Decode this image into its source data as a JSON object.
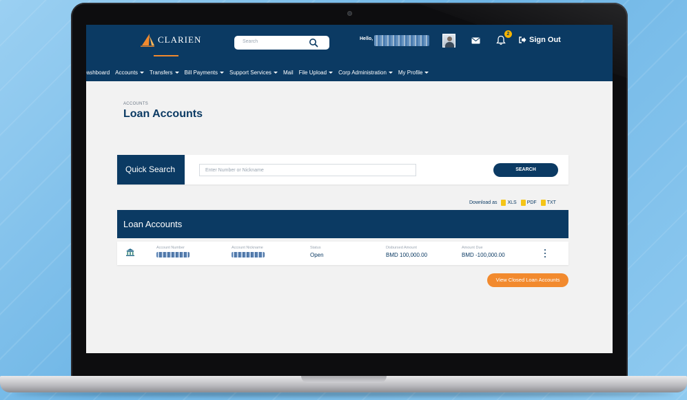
{
  "header": {
    "logo_text": "CLARIEN",
    "search_placeholder": "Search",
    "greeting": "Hello,",
    "notification_count": "2",
    "sign_out_label": "Sign Out"
  },
  "nav": {
    "items": [
      {
        "label": "Dashboard",
        "dropdown": false
      },
      {
        "label": "Accounts",
        "dropdown": true
      },
      {
        "label": "Transfers",
        "dropdown": true
      },
      {
        "label": "Bill Payments",
        "dropdown": true
      },
      {
        "label": "Support Services",
        "dropdown": true
      },
      {
        "label": "Mail",
        "dropdown": false
      },
      {
        "label": "File Upload",
        "dropdown": true
      },
      {
        "label": "Corp Administration",
        "dropdown": true
      },
      {
        "label": "My Profile",
        "dropdown": true
      }
    ]
  },
  "page": {
    "breadcrumb": "ACCOUNTS",
    "title": "Loan Accounts"
  },
  "quick_search": {
    "label": "Quick Search",
    "input_placeholder": "Enter Number or Nickname",
    "button_label": "SEARCH"
  },
  "download": {
    "label": "Download as",
    "formats": [
      "XLS",
      "PDF",
      "TXT"
    ]
  },
  "loan_accounts": {
    "header": "Loan Accounts",
    "columns": [
      "Account Number",
      "Account Nickname",
      "Status",
      "Disbursed Amount",
      "Amount Due"
    ],
    "rows": [
      {
        "status": "Open",
        "disbursed_amount": "BMD 100,000.00",
        "amount_due": "BMD -100,000.00"
      }
    ],
    "view_closed_label": "View Closed Loan Accounts"
  },
  "colors": {
    "brand_navy": "#0b3a63",
    "accent_orange": "#f28a2e",
    "badge_yellow": "#f5b400"
  }
}
